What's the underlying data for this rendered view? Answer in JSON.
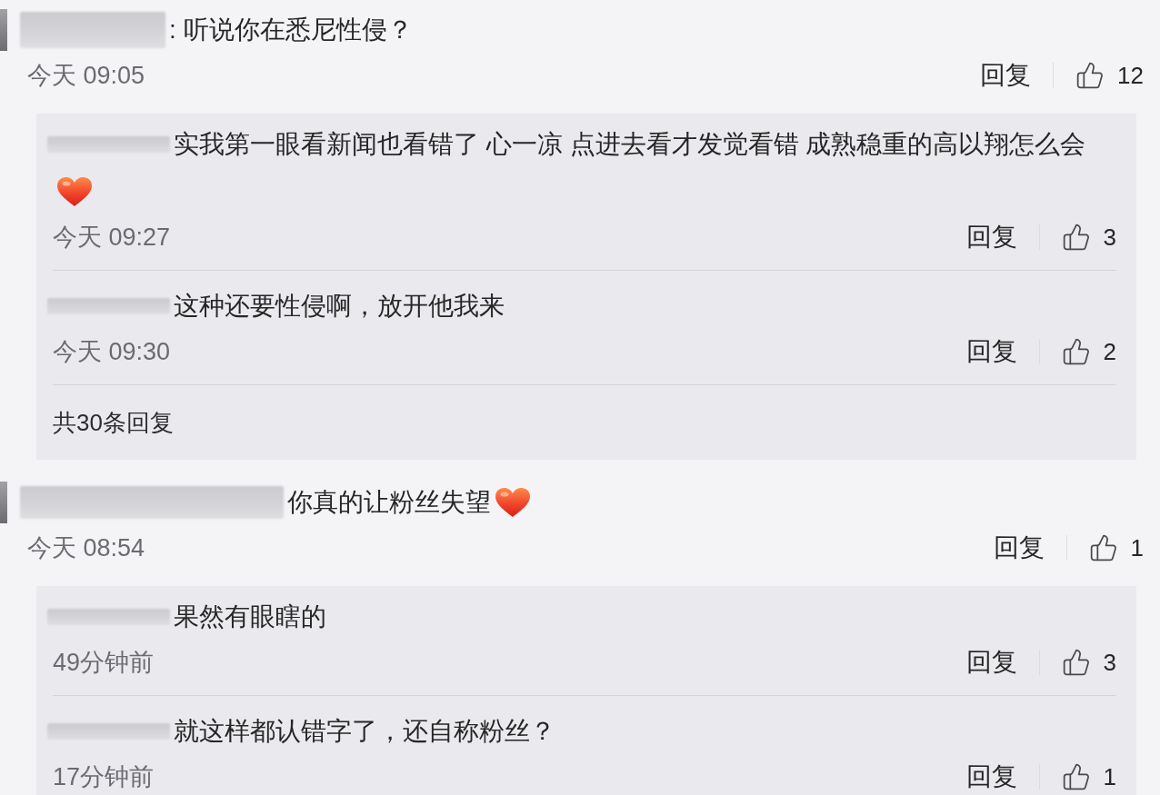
{
  "comments": [
    {
      "text": ": 听说你在悉尼性侵？",
      "time": "今天 09:05",
      "reply_label": "回复",
      "likes": "12",
      "replies": [
        {
          "text": "实我第一眼看新闻也看错了 心一凉 点进去看才发觉看错 成熟稳重的高以翔怎么会",
          "heart_emoji": true,
          "time": "今天 09:27",
          "reply_label": "回复",
          "likes": "3"
        },
        {
          "text": "这种还要性侵啊，放开他我来",
          "time": "今天 09:30",
          "reply_label": "回复",
          "likes": "2"
        }
      ],
      "more_replies": "共30条回复"
    },
    {
      "text": "你真的让粉丝失望",
      "heart_emoji": true,
      "time": "今天 08:54",
      "reply_label": "回复",
      "likes": "1",
      "replies": [
        {
          "text": "果然有眼瞎的",
          "time": "49分钟前",
          "reply_label": "回复",
          "likes": "3"
        },
        {
          "text": "就这样都认错字了，还自称粉丝？",
          "time": "17分钟前",
          "reply_label": "回复",
          "likes": "1"
        }
      ]
    }
  ]
}
